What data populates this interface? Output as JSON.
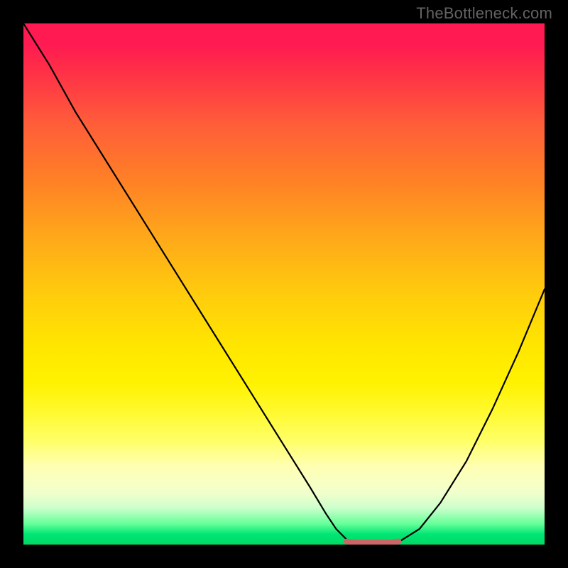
{
  "watermark": {
    "text": "TheBottleneck.com"
  },
  "colors": {
    "frame": "#000000",
    "curve_stroke": "#000000",
    "flat_segment": "#cc6666",
    "watermark_text": "#636363"
  },
  "chart_data": {
    "type": "line",
    "title": "",
    "xlabel": "",
    "ylabel": "",
    "xlim": [
      0,
      100
    ],
    "ylim": [
      0,
      100
    ],
    "grid": false,
    "legend": false,
    "series": [
      {
        "name": "bottleneck-curve",
        "x": [
          0,
          5,
          10,
          15,
          20,
          25,
          30,
          35,
          40,
          45,
          50,
          55,
          58,
          60,
          62,
          64,
          66,
          68,
          70,
          72,
          76,
          80,
          85,
          90,
          95,
          100
        ],
        "values": [
          100,
          92,
          83,
          75,
          67,
          59,
          51,
          43,
          35,
          27,
          19,
          11,
          6,
          3,
          1,
          0,
          0,
          0,
          0,
          0.5,
          3,
          8,
          16,
          26,
          37,
          49
        ]
      },
      {
        "name": "optimal-flat-segment",
        "x": [
          62,
          64,
          66,
          68,
          70,
          72
        ],
        "values": [
          0.6,
          0.4,
          0.4,
          0.4,
          0.4,
          0.6
        ]
      }
    ],
    "annotations": []
  }
}
